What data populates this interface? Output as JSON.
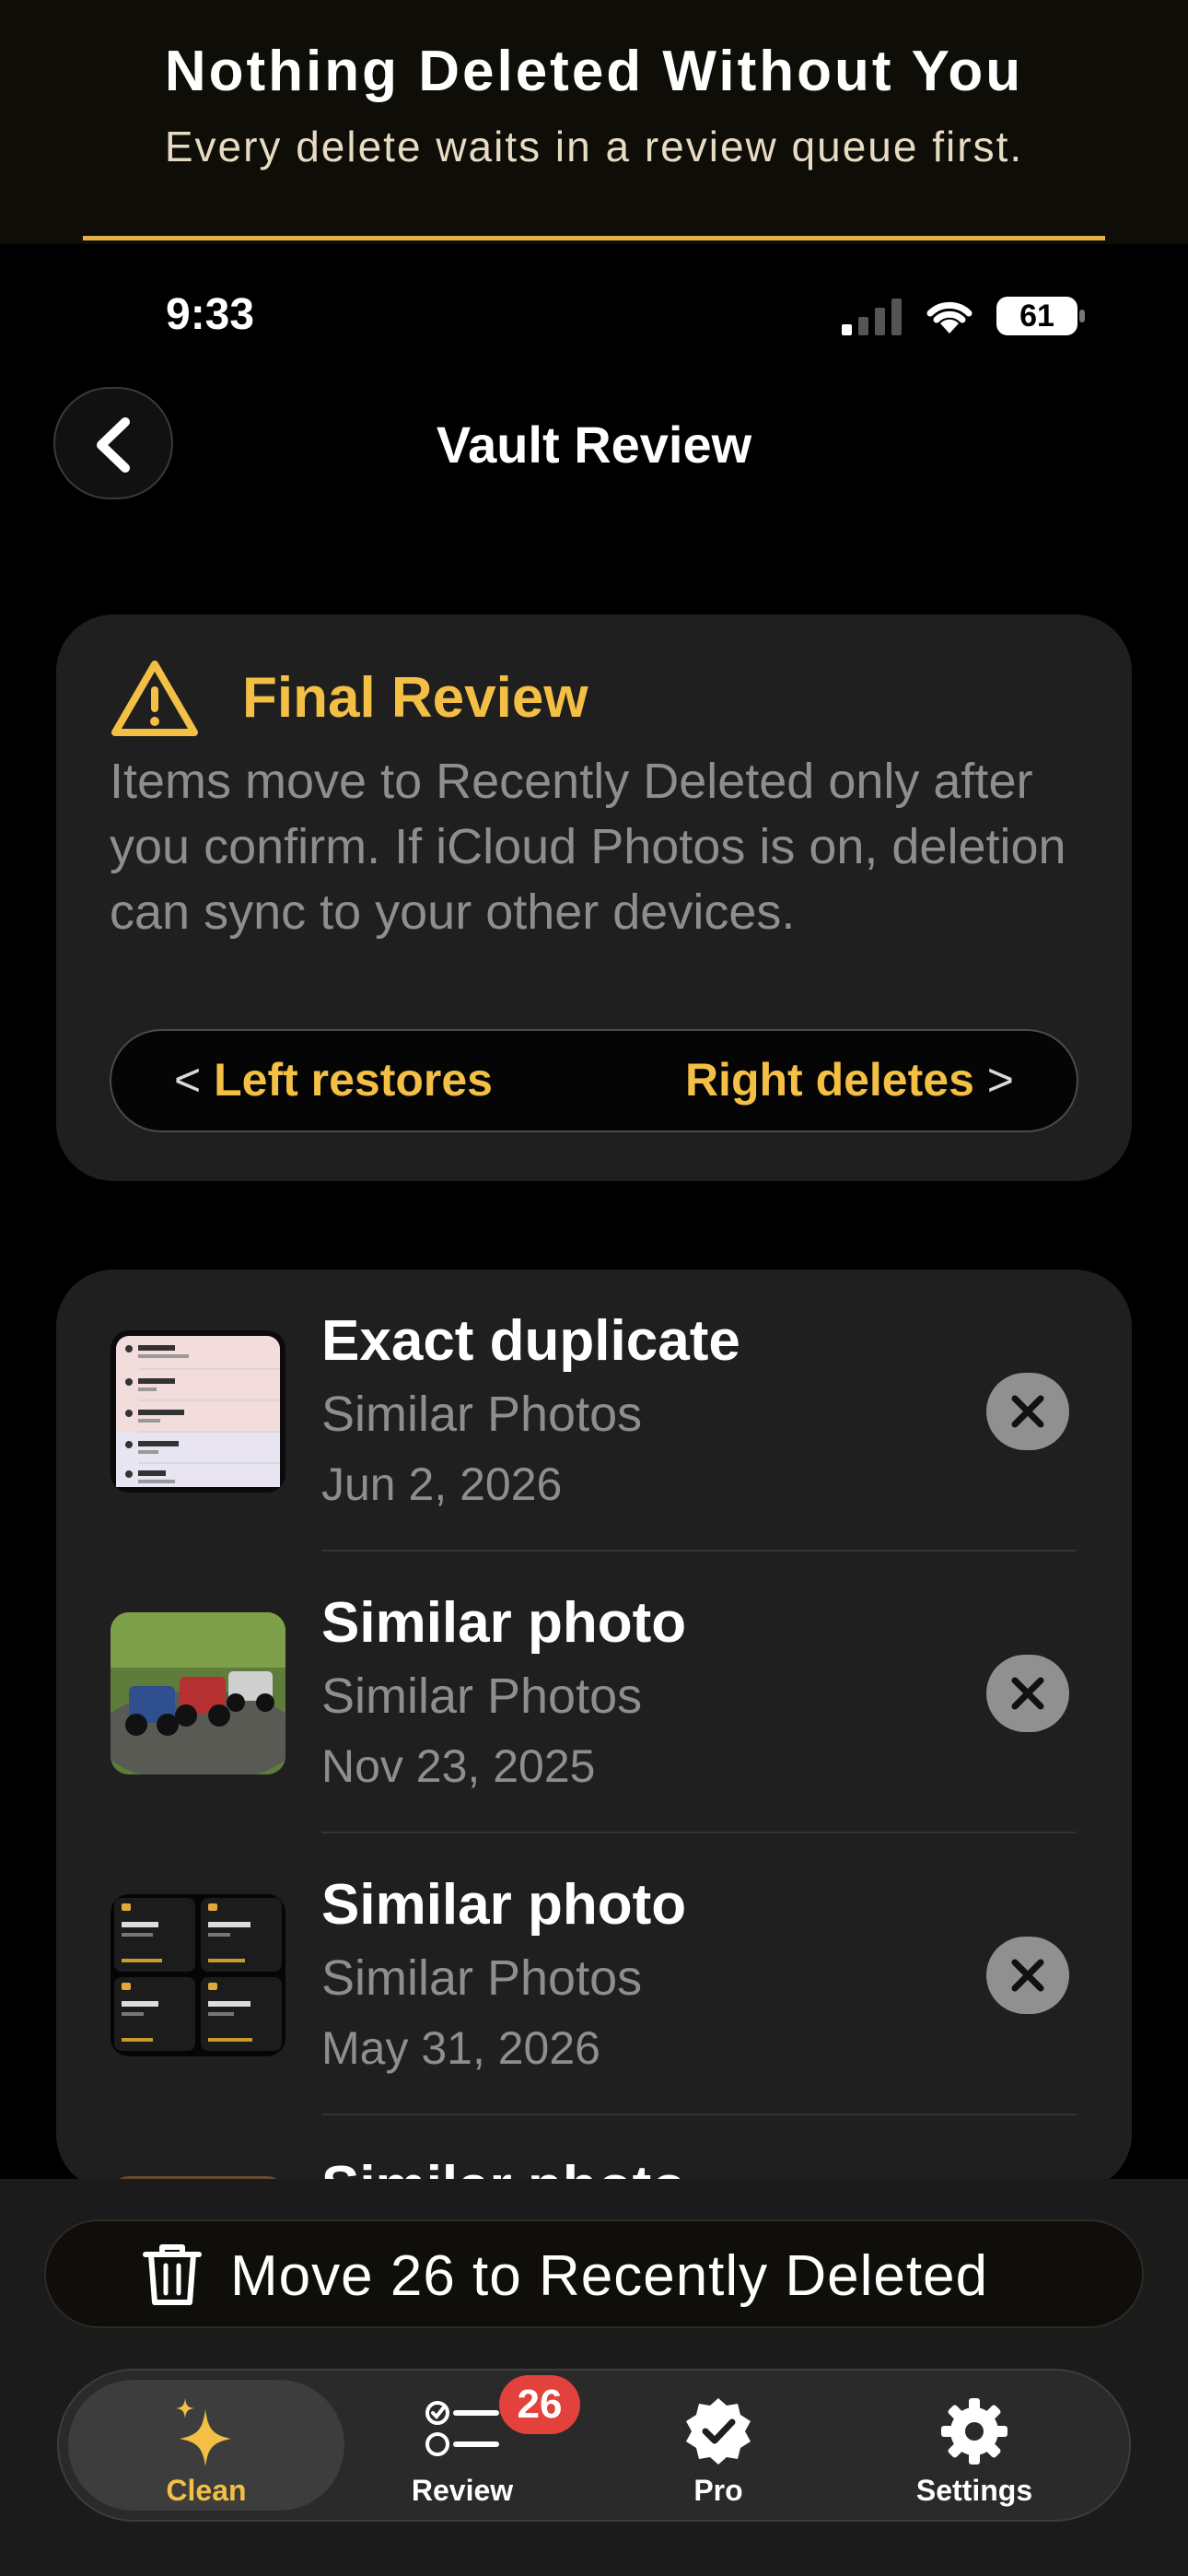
{
  "promo": {
    "title": "Nothing Deleted Without You",
    "subtitle": "Every delete waits in a review queue first."
  },
  "status_bar": {
    "time": "9:33",
    "battery": "61"
  },
  "nav": {
    "title": "Vault Review",
    "back_icon": "chevron-left-icon"
  },
  "review_card": {
    "title": "Final Review",
    "icon": "warning-triangle-icon",
    "body": "Items move to Recently Deleted only after you confirm. If iCloud Photos is on, deletion can sync to your other devices.",
    "left_chevron": "<",
    "left_label": "Left restores",
    "right_label": "Right deletes",
    "right_chevron": ">"
  },
  "items": [
    {
      "title": "Exact duplicate",
      "category": "Similar Photos",
      "date": "Jun 2, 2026",
      "thumb": "screenshot-decks-list"
    },
    {
      "title": "Similar photo",
      "category": "Similar Photos",
      "date": "Nov 23, 2025",
      "thumb": "rc-trucks-photo"
    },
    {
      "title": "Similar photo",
      "category": "Similar Photos",
      "date": "May 31, 2026",
      "thumb": "screenshot-app-grid"
    },
    {
      "title": "Similar photo",
      "category": "",
      "date": "",
      "thumb": "partial-photo"
    }
  ],
  "action": {
    "move_label": "Move 26 to Recently Deleted",
    "icon": "trash-icon"
  },
  "tabs": [
    {
      "label": "Clean",
      "icon": "sparkles-icon",
      "active": true
    },
    {
      "label": "Review",
      "icon": "checklist-icon",
      "badge": "26"
    },
    {
      "label": "Pro",
      "icon": "verified-badge-icon"
    },
    {
      "label": "Settings",
      "icon": "gear-icon"
    }
  ],
  "colors": {
    "accent": "#F3BF45",
    "badge": "#E3413B",
    "card": "#1F1F1F"
  }
}
